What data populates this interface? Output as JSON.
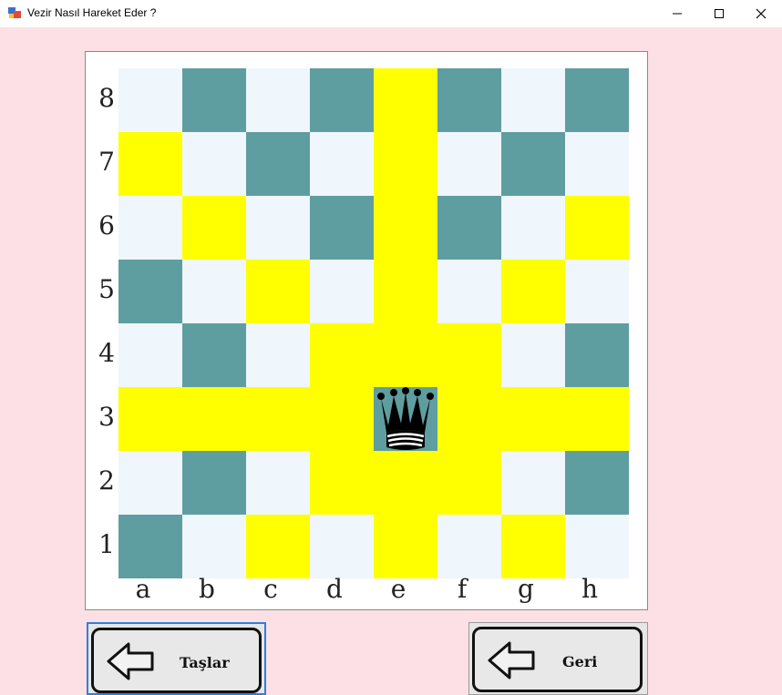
{
  "window": {
    "title": "Vezir Nasıl Hareket Eder ?"
  },
  "board": {
    "files": [
      "a",
      "b",
      "c",
      "d",
      "e",
      "f",
      "g",
      "h"
    ],
    "ranks": [
      "8",
      "7",
      "6",
      "5",
      "4",
      "3",
      "2",
      "1"
    ],
    "queen_square": "e3",
    "piece": "queen-icon",
    "colors": {
      "light": "#eff6fc",
      "dark": "#5f9ea0",
      "highlight": "#ffff00"
    },
    "highlighted_squares": [
      "a3",
      "b3",
      "c3",
      "d3",
      "f3",
      "g3",
      "h3",
      "e1",
      "e2",
      "e4",
      "e5",
      "e6",
      "e7",
      "e8",
      "d2",
      "d4",
      "f2",
      "f4",
      "c1",
      "c5",
      "b6",
      "a7",
      "g1",
      "g5",
      "h6"
    ]
  },
  "buttons": {
    "pieces_label": "Taşlar",
    "back_label": "Geri"
  }
}
